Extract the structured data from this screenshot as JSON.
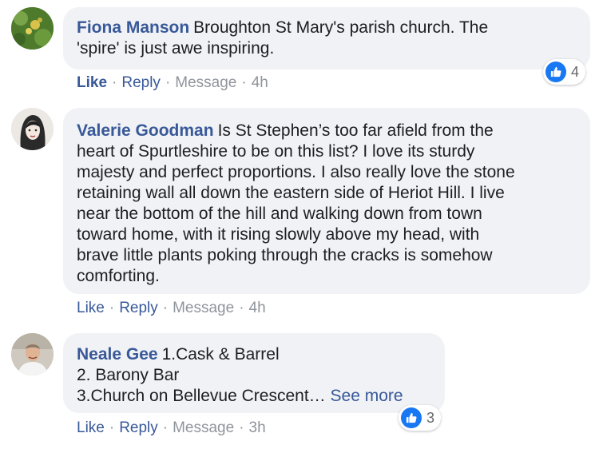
{
  "comments": [
    {
      "author": "Fiona Manson",
      "lines": [
        "Broughton St Mary's parish church. The",
        "'spire' is just awe inspiring."
      ],
      "actions": {
        "like": "Like",
        "reply": "Reply",
        "message": "Message",
        "time": "4h"
      },
      "reactions": {
        "icon": "thumbs-up-icon",
        "count": "4"
      }
    },
    {
      "author": "Valerie Goodman",
      "lines": [
        "Is St Stephen’s too far afield from the",
        "heart of Spurtleshire to be on this list? I love its sturdy",
        "majesty and perfect proportions. I also really love the stone",
        "retaining wall all down the eastern side of Heriot Hill. I live",
        "near the bottom of the hill and walking down from town",
        "toward home, with it rising slowly above my head, with",
        "brave little plants poking through the cracks is somehow",
        "comforting."
      ],
      "actions": {
        "like": "Like",
        "reply": "Reply",
        "message": "Message",
        "time": "4h"
      }
    },
    {
      "author": "Neale Gee",
      "lines": [
        "1.Cask & Barrel",
        "2. Barony Bar",
        "3.Church on Bellevue Crescent…"
      ],
      "see_more": "See more",
      "actions": {
        "like": "Like",
        "reply": "Reply",
        "message": "Message",
        "time": "3h"
      },
      "reactions": {
        "icon": "thumbs-up-icon",
        "count": "3"
      }
    }
  ],
  "separator": "·",
  "colors": {
    "link": "#385898",
    "bubble": "#f0f2f5",
    "muted": "#90949c",
    "like_blue": "#1877f2"
  }
}
